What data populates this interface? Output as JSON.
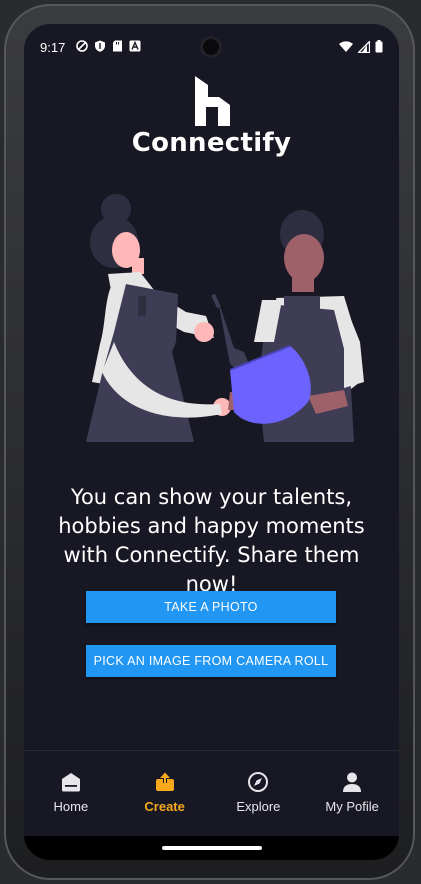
{
  "status_bar": {
    "time": "9:17",
    "left_icons": [
      "vpn-shield-icon",
      "shield-icon",
      "sd-card-icon",
      "font-a-icon"
    ],
    "right_icons": [
      "wifi-icon",
      "signal-icon",
      "battery-icon"
    ]
  },
  "app": {
    "name": "Connectify"
  },
  "content": {
    "message": "You can show your talents, hobbies and happy moments with Connectify. Share them now!",
    "take_photo_label": "TAKE A PHOTO",
    "camera_roll_label": "PICK AN IMAGE FROM CAMERA ROLL"
  },
  "bottom_nav": {
    "items": [
      {
        "label": "Home",
        "icon": "home-icon",
        "active": false
      },
      {
        "label": "Create",
        "icon": "upload-icon",
        "active": true
      },
      {
        "label": "Explore",
        "icon": "compass-icon",
        "active": false
      },
      {
        "label": "My Pofile",
        "icon": "person-icon",
        "active": false
      }
    ]
  },
  "colors": {
    "background": "#181824",
    "accent": "#2196f3",
    "active_nav": "#f7a81b",
    "text": "#ffffff"
  }
}
